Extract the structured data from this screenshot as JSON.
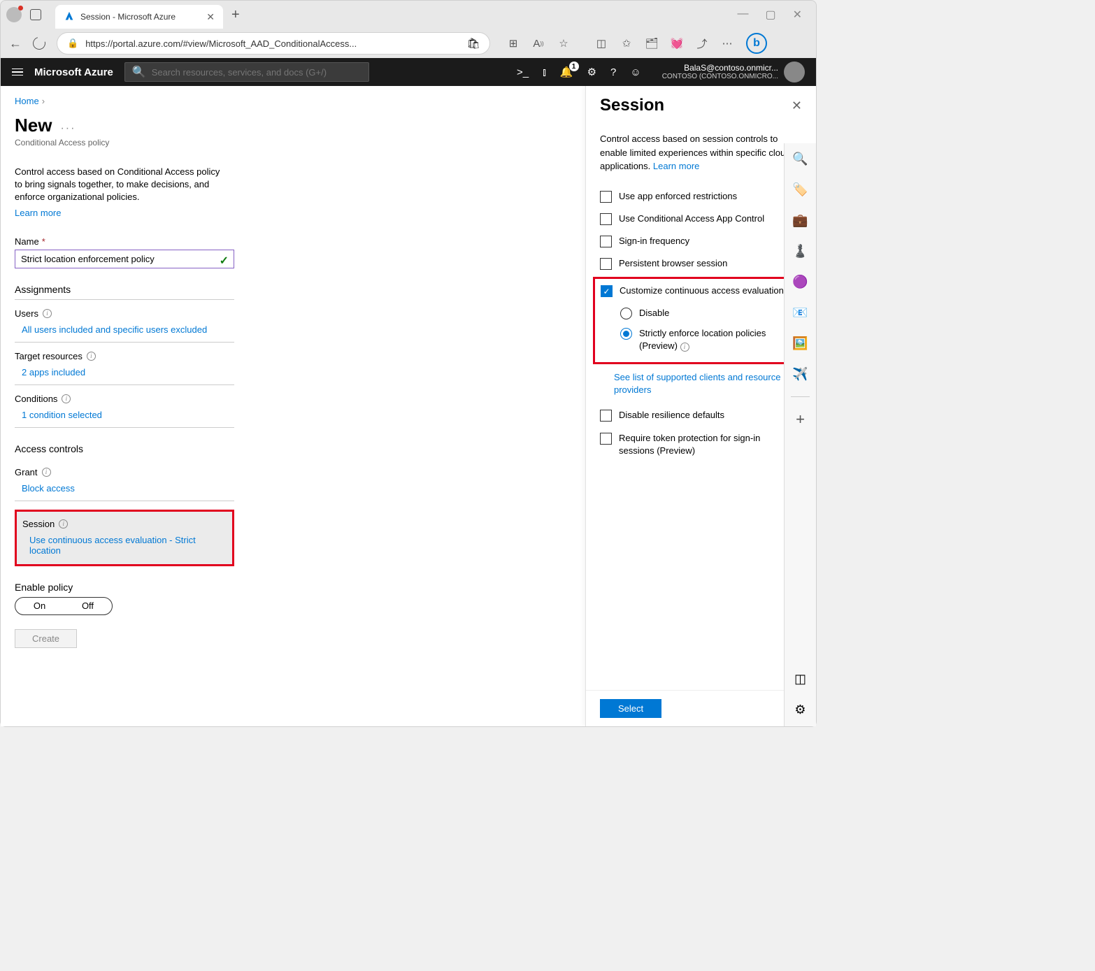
{
  "browser": {
    "tab_title": "Session - Microsoft Azure",
    "url": "https://portal.azure.com/#view/Microsoft_AAD_ConditionalAccess..."
  },
  "azure_topbar": {
    "brand": "Microsoft Azure",
    "search_placeholder": "Search resources, services, and docs (G+/)",
    "notification_count": "1",
    "user_email": "BalaS@contoso.onmicr...",
    "user_tenant": "CONTOSO (CONTOSO.ONMICRO..."
  },
  "breadcrumb": {
    "home": "Home"
  },
  "page": {
    "title": "New",
    "subtitle": "Conditional Access policy",
    "description": "Control access based on Conditional Access policy to bring signals together, to make decisions, and enforce organizational policies.",
    "learn_more": "Learn more"
  },
  "form": {
    "name_label": "Name",
    "name_value": "Strict location enforcement policy",
    "assignments_header": "Assignments",
    "users_label": "Users",
    "users_value": "All users included and specific users excluded",
    "target_label": "Target resources",
    "target_value": "2 apps included",
    "conditions_label": "Conditions",
    "conditions_value": "1 condition selected",
    "access_controls_header": "Access controls",
    "grant_label": "Grant",
    "grant_value": "Block access",
    "session_label": "Session",
    "session_value": "Use continuous access evaluation - Strict location",
    "enable_label": "Enable policy",
    "toggle_on": "On",
    "toggle_off": "Off",
    "create_button": "Create"
  },
  "panel": {
    "title": "Session",
    "description": "Control access based on session controls to enable limited experiences within specific cloud applications.",
    "learn_more": "Learn more",
    "options": {
      "app_enforced": "Use app enforced restrictions",
      "ca_app_control": "Use Conditional Access App Control",
      "signin_freq": "Sign-in frequency",
      "persistent": "Persistent browser session",
      "customize_cae": "Customize continuous access evaluation",
      "cae_disable": "Disable",
      "cae_strict": "Strictly enforce location policies (Preview)",
      "supported_link": "See list of supported clients and resource providers",
      "disable_resilience": "Disable resilience defaults",
      "token_protection": "Require token protection for sign-in sessions (Preview)"
    },
    "select_button": "Select"
  }
}
